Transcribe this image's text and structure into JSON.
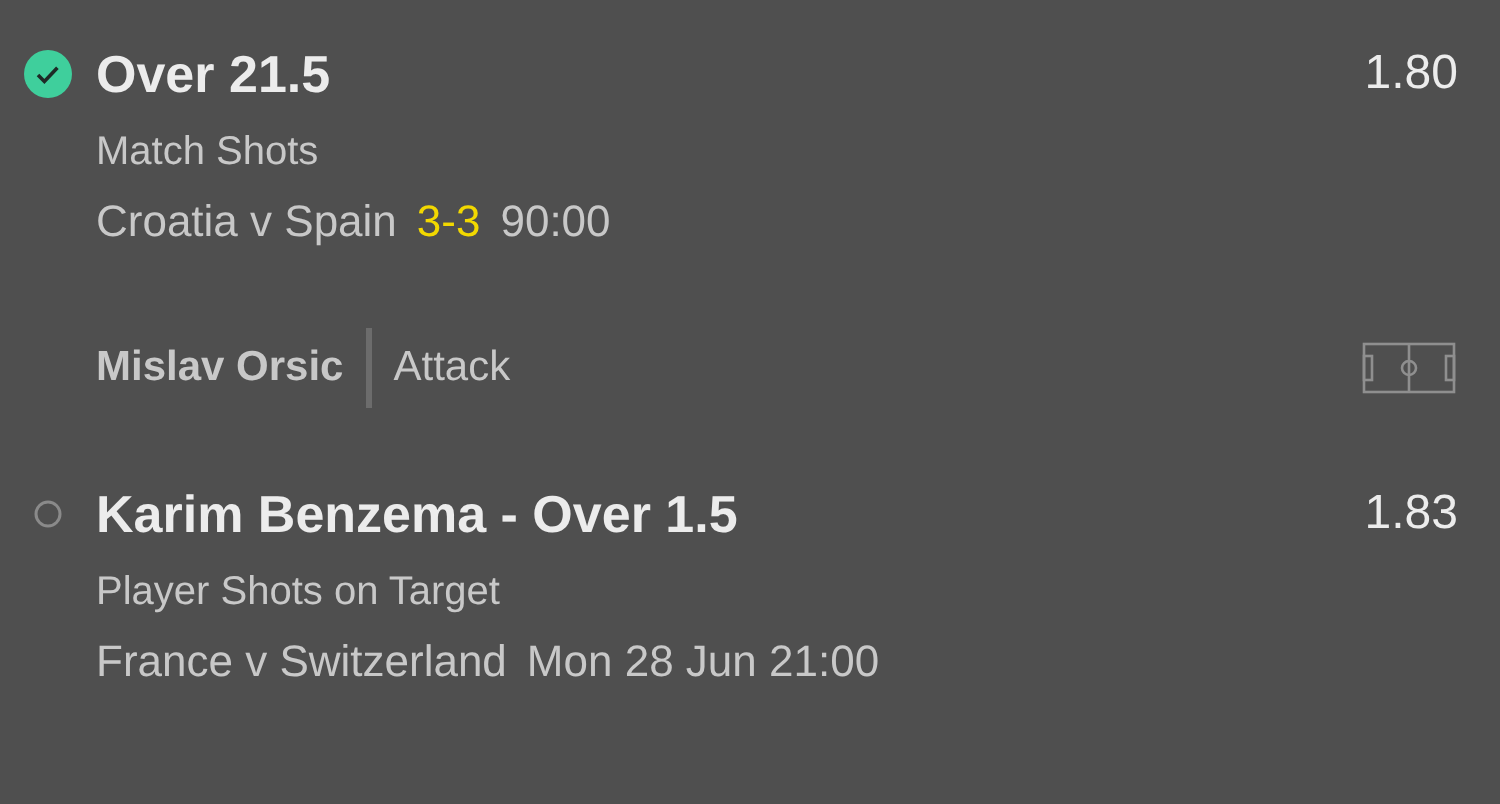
{
  "selections": [
    {
      "won": true,
      "title": "Over 21.5",
      "odds": "1.80",
      "market": "Match Shots",
      "event": "Croatia v Spain",
      "score": "3-3",
      "time": "90:00",
      "player": {
        "name": "Mislav Orsic",
        "position": "Attack"
      }
    },
    {
      "won": false,
      "title": "Karim Benzema - Over 1.5",
      "odds": "1.83",
      "market": "Player Shots on Target",
      "event": "France v Switzerland",
      "time": "Mon 28 Jun 21:00"
    }
  ]
}
